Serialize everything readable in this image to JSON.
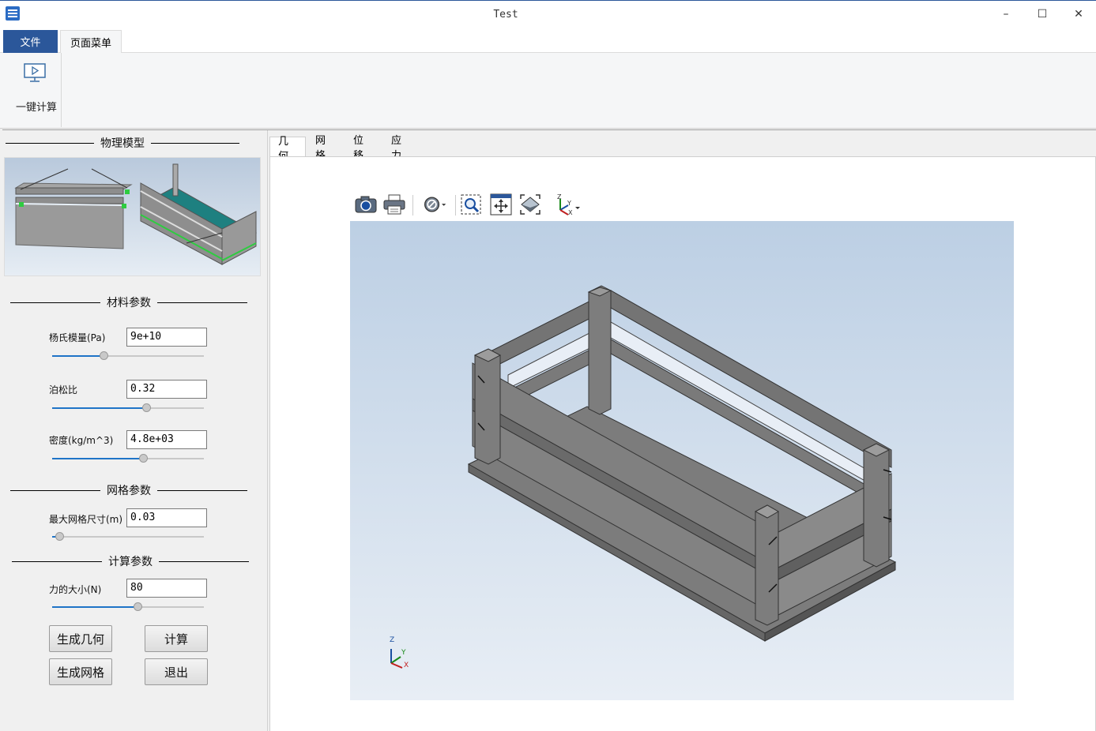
{
  "window": {
    "title": "Test",
    "minimize": "–",
    "maximize": "☐",
    "close": "✕"
  },
  "ribbon": {
    "tabs": [
      "文件",
      "页面菜单"
    ],
    "calc_button_label": "一键计算"
  },
  "left_panel": {
    "physical_model_title": "物理模型",
    "material_title": "材料参数",
    "mesh_title": "网格参数",
    "calc_title": "计算参数",
    "params": {
      "youngs": {
        "label": "杨氏模量(Pa)",
        "value": "9e+10",
        "slider": 0.33
      },
      "poisson": {
        "label": "泊松比",
        "value": "0.32",
        "slider": 0.63
      },
      "density": {
        "label": "密度(kg/m^3)",
        "value": "4.8e+03",
        "slider": 0.61
      },
      "mesh_size": {
        "label": "最大网格尺寸(m)",
        "value": "0.03",
        "slider": 0.02
      },
      "force": {
        "label": "力的大小(N)",
        "value": "80",
        "slider": 0.57
      }
    },
    "buttons": {
      "gen_geometry": "生成几何",
      "calculate": "计算",
      "gen_mesh": "生成网格",
      "exit": "退出"
    }
  },
  "view_tabs": [
    "几何",
    "网格",
    "位移",
    "应力"
  ],
  "axes_triad": {
    "z": "Z",
    "y": "Y",
    "x": "X"
  },
  "toolbar_icons": [
    "camera-icon",
    "print-icon",
    "display-mode-icon",
    "zoom-window-icon",
    "fit-all-icon",
    "view-orientation-icon",
    "axes-icon"
  ]
}
